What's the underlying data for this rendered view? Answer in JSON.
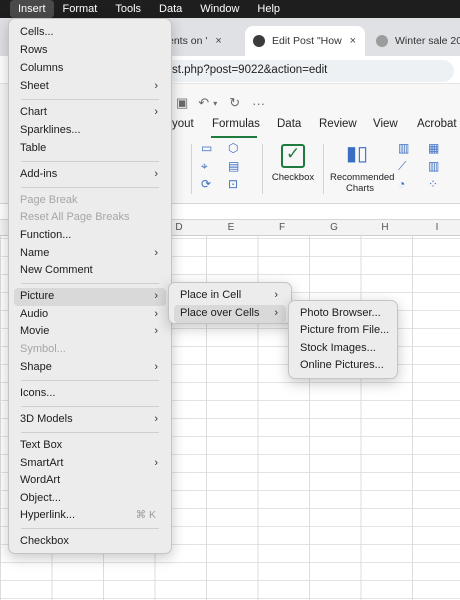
{
  "menubar": {
    "items": [
      "Insert",
      "Format",
      "Tools",
      "Data",
      "Window",
      "Help"
    ]
  },
  "browser": {
    "tabs": [
      {
        "label": "ents on '",
        "close": "×"
      },
      {
        "label": "Edit Post \"How",
        "close": "×"
      },
      {
        "label": "Winter sale 20",
        "close": ""
      }
    ],
    "address_text": "st.php?post=9022&action=edit"
  },
  "ribbon": {
    "tabs": [
      "yout",
      "Formulas",
      "Data",
      "Review",
      "View",
      "Acrobat"
    ],
    "active_tab": "Formulas",
    "checkbox_label": "Checkbox",
    "recommended_charts_label": "Recommended Charts",
    "qat_more": "···"
  },
  "grid": {
    "columns": [
      "D",
      "E",
      "F",
      "G",
      "H",
      "I"
    ]
  },
  "insert_menu": {
    "items": [
      {
        "label": "Cells...",
        "submenu": false,
        "disabled": false
      },
      {
        "label": "Rows",
        "submenu": false,
        "disabled": false
      },
      {
        "label": "Columns",
        "submenu": false,
        "disabled": false
      },
      {
        "label": "Sheet",
        "submenu": true,
        "disabled": false
      },
      {
        "label": "Chart",
        "submenu": true,
        "disabled": false
      },
      {
        "label": "Sparklines...",
        "submenu": false,
        "disabled": false
      },
      {
        "label": "Table",
        "submenu": false,
        "disabled": false
      },
      {
        "label": "Add-ins",
        "submenu": true,
        "disabled": false
      },
      {
        "label": "Page Break",
        "submenu": false,
        "disabled": true
      },
      {
        "label": "Reset All Page Breaks",
        "submenu": false,
        "disabled": true
      },
      {
        "label": "Function...",
        "submenu": false,
        "disabled": false
      },
      {
        "label": "Name",
        "submenu": true,
        "disabled": false
      },
      {
        "label": "New Comment",
        "submenu": false,
        "disabled": false
      },
      {
        "label": "Picture",
        "submenu": true,
        "disabled": false,
        "highlighted": true
      },
      {
        "label": "Audio",
        "submenu": true,
        "disabled": false
      },
      {
        "label": "Movie",
        "submenu": true,
        "disabled": false
      },
      {
        "label": "Symbol...",
        "submenu": false,
        "disabled": true
      },
      {
        "label": "Shape",
        "submenu": true,
        "disabled": false
      },
      {
        "label": "Icons...",
        "submenu": false,
        "disabled": false
      },
      {
        "label": "3D Models",
        "submenu": true,
        "disabled": false
      },
      {
        "label": "Text Box",
        "submenu": false,
        "disabled": false
      },
      {
        "label": "SmartArt",
        "submenu": true,
        "disabled": false
      },
      {
        "label": "WordArt",
        "submenu": false,
        "disabled": false
      },
      {
        "label": "Object...",
        "submenu": false,
        "disabled": false
      },
      {
        "label": "Hyperlink...",
        "submenu": false,
        "disabled": false,
        "shortcut": "⌘ K"
      },
      {
        "label": "Checkbox",
        "submenu": false,
        "disabled": false
      }
    ]
  },
  "picture_menu": {
    "items": [
      {
        "label": "Place in Cell",
        "submenu": true
      },
      {
        "label": "Place over Cells",
        "submenu": true,
        "highlighted": true
      }
    ]
  },
  "place_over_cells_menu": {
    "items": [
      "Photo Browser...",
      "Picture from File...",
      "Stock Images...",
      "Online Pictures..."
    ]
  },
  "colors": {
    "menubar_bg": "#1e1e1e",
    "menu_bg": "#ececec",
    "highlight": "#d9d9d9",
    "excel_green": "#1f7a3d"
  }
}
